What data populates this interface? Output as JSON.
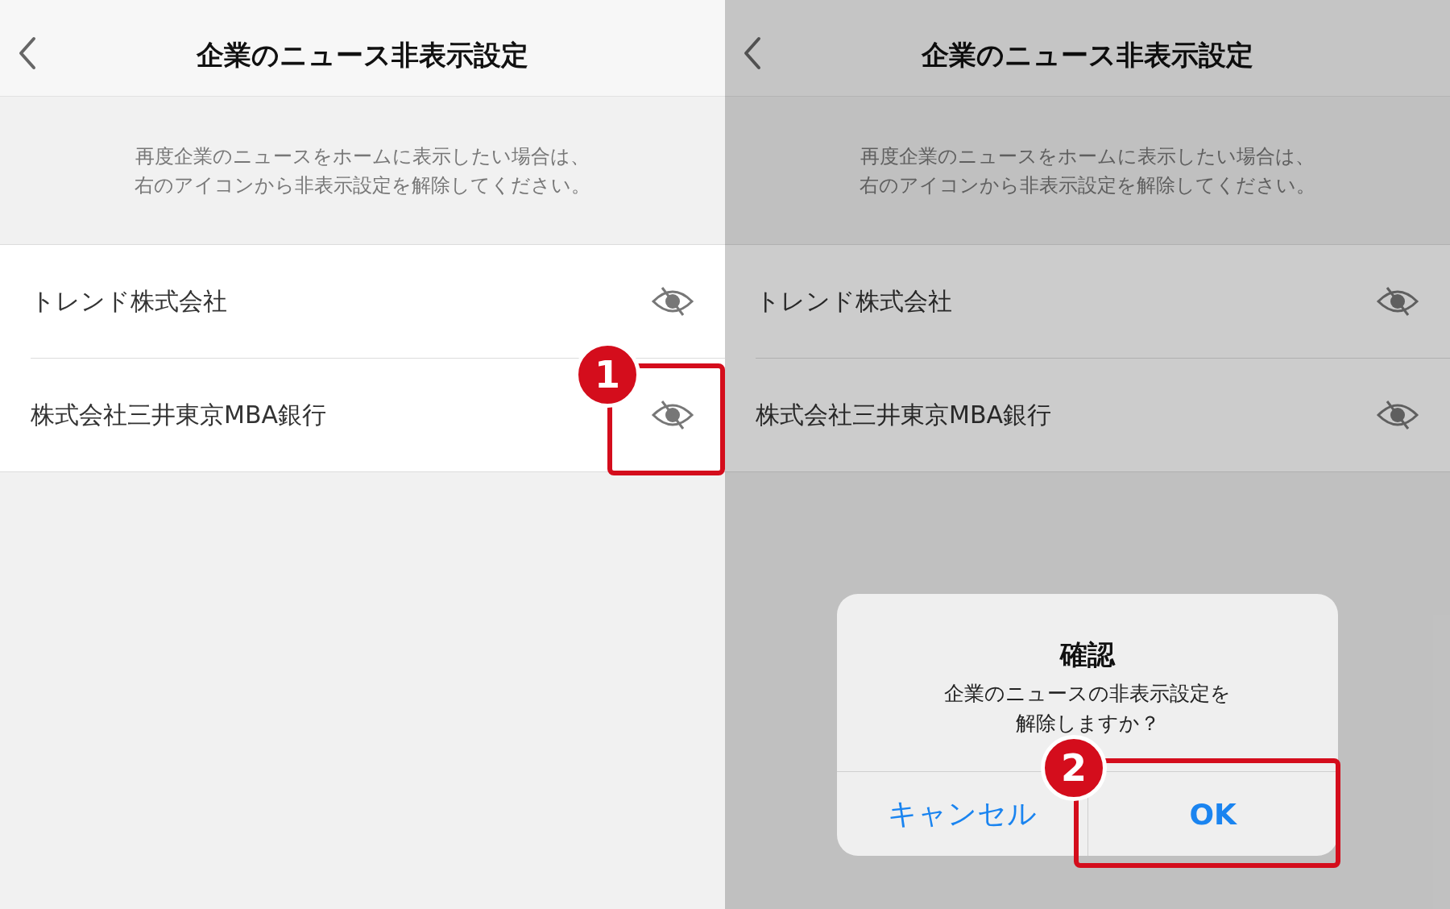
{
  "screens": [
    {
      "title": "企業のニュース非表示設定",
      "description_lines": [
        "再度企業のニュースをホームに表示したい場合は、",
        "右のアイコンから非表示設定を解除してください。"
      ],
      "companies": [
        {
          "name": "トレンド株式会社"
        },
        {
          "name": "株式会社三井東京MBA銀行"
        }
      ],
      "dimmed": false,
      "callout": {
        "number": "1"
      }
    },
    {
      "title": "企業のニュース非表示設定",
      "description_lines": [
        "再度企業のニュースをホームに表示したい場合は、",
        "右のアイコンから非表示設定を解除してください。"
      ],
      "companies": [
        {
          "name": "トレンド株式会社"
        },
        {
          "name": "株式会社三井東京MBA銀行"
        }
      ],
      "dimmed": true,
      "dialog": {
        "title": "確認",
        "message_lines": [
          "企業のニュースの非表示設定を",
          "解除しますか？"
        ],
        "buttons": [
          {
            "label": "キャンセル",
            "bold": false
          },
          {
            "label": "OK",
            "bold": true
          }
        ]
      },
      "callout": {
        "number": "2"
      }
    }
  ]
}
